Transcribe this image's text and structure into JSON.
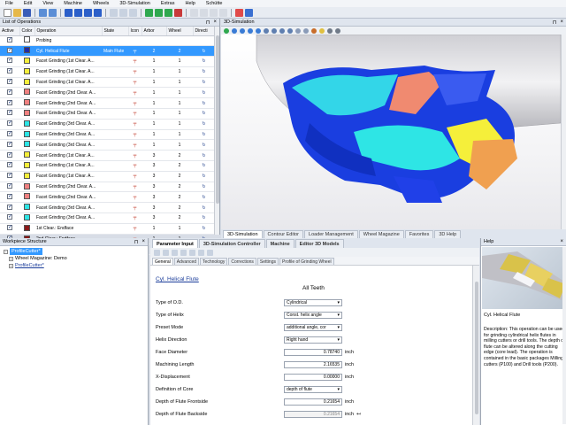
{
  "menu": [
    "File",
    "Edit",
    "View",
    "Machine",
    "Wheels",
    "3D-Simulation",
    "Extras",
    "Help",
    "Schütte"
  ],
  "operations": {
    "title": "List of Operations",
    "columns": [
      "Active",
      "Color",
      "Operation",
      "State",
      "Icon",
      "Arbor",
      "Wheel",
      "Directi"
    ],
    "rows": [
      {
        "color": "#ffffff",
        "name": "Probing",
        "state": "",
        "arbor": "",
        "wheel": "",
        "dir": false
      },
      {
        "color": "#1e2aa8",
        "name": "Cyl. Helical Flute",
        "state": "Main Flute",
        "arbor": "2",
        "wheel": "2",
        "dir": true,
        "selected": true
      },
      {
        "color": "#f5ef3a",
        "name": "Facet Grinding (1st Clear. A...",
        "state": "",
        "arbor": "1",
        "wheel": "1",
        "dir": true
      },
      {
        "color": "#f5ef3a",
        "name": "Facet Grinding (1st Clear. A...",
        "state": "",
        "arbor": "1",
        "wheel": "1",
        "dir": true
      },
      {
        "color": "#f5ef3a",
        "name": "Facet Grinding (1st Clear. A...",
        "state": "",
        "arbor": "1",
        "wheel": "1",
        "dir": true
      },
      {
        "color": "#f08080",
        "name": "Facet Grinding (2nd Clear. A...",
        "state": "",
        "arbor": "1",
        "wheel": "1",
        "dir": true
      },
      {
        "color": "#f08080",
        "name": "Facet Grinding (2nd Clear. A...",
        "state": "",
        "arbor": "1",
        "wheel": "1",
        "dir": true
      },
      {
        "color": "#f08080",
        "name": "Facet Grinding (2nd Clear. A...",
        "state": "",
        "arbor": "1",
        "wheel": "1",
        "dir": true
      },
      {
        "color": "#2ee5e5",
        "name": "Facet Grinding (3rd Clear. A...",
        "state": "",
        "arbor": "1",
        "wheel": "1",
        "dir": true
      },
      {
        "color": "#2ee5e5",
        "name": "Facet Grinding (3rd Clear. A...",
        "state": "",
        "arbor": "1",
        "wheel": "1",
        "dir": true
      },
      {
        "color": "#2ee5e5",
        "name": "Facet Grinding (3rd Clear. A...",
        "state": "",
        "arbor": "1",
        "wheel": "1",
        "dir": true
      },
      {
        "color": "#f5ef3a",
        "name": "Facet Grinding (1st Clear. A...",
        "state": "",
        "arbor": "3",
        "wheel": "2",
        "dir": true
      },
      {
        "color": "#f5ef3a",
        "name": "Facet Grinding (1st Clear. A...",
        "state": "",
        "arbor": "3",
        "wheel": "2",
        "dir": true
      },
      {
        "color": "#f5ef3a",
        "name": "Facet Grinding (1st Clear. A...",
        "state": "",
        "arbor": "3",
        "wheel": "2",
        "dir": true
      },
      {
        "color": "#f08080",
        "name": "Facet Grinding (2nd Clear. A...",
        "state": "",
        "arbor": "3",
        "wheel": "2",
        "dir": true
      },
      {
        "color": "#f08080",
        "name": "Facet Grinding (2nd Clear. A...",
        "state": "",
        "arbor": "3",
        "wheel": "2",
        "dir": true
      },
      {
        "color": "#2ee5e5",
        "name": "Facet Grinding (3rd Clear. A...",
        "state": "",
        "arbor": "3",
        "wheel": "2",
        "dir": true
      },
      {
        "color": "#2ee5e5",
        "name": "Facet Grinding (3rd Clear. A...",
        "state": "",
        "arbor": "3",
        "wheel": "2",
        "dir": true
      },
      {
        "color": "#8b1a1a",
        "name": "1st Clear.: Endface",
        "state": "",
        "arbor": "1",
        "wheel": "1",
        "dir": true
      },
      {
        "color": "#8b1a1a",
        "name": "2nd Clear.: Endface",
        "state": "",
        "arbor": "1",
        "wheel": "1",
        "dir": true
      },
      {
        "color": "#ff8c00",
        "name": "End Gash",
        "state": "",
        "arbor": "3",
        "wheel": "2",
        "dir": true
      }
    ]
  },
  "simulation": {
    "title": "3D-Simulation",
    "tabs": [
      "3D-Simulation",
      "Contour Editor",
      "Loader Management",
      "Wheel Magazine",
      "Favorites",
      "3D Help"
    ],
    "active_tab": 0
  },
  "workpiece": {
    "title": "Workpiece Structure",
    "items": [
      "ProfileCutter*",
      "Wheel Magazine: Demo",
      "ProfileCutter*"
    ]
  },
  "param": {
    "tabs": [
      "Parameter Input",
      "3D-Simulation Controller",
      "Machine",
      "Editor 3D Models"
    ],
    "subtabs": [
      "General",
      "Advanced",
      "Technology",
      "Corrections",
      "Settings",
      "Profile of Grinding Wheel"
    ],
    "operation_link": "Cyl. Helical Flute",
    "heading": "All Teeth",
    "fields": [
      {
        "label": "Type of O.D.",
        "value": "Cylindrical",
        "type": "select",
        "unit": ""
      },
      {
        "label": "Type of Helix",
        "value": "Const. helix angle",
        "type": "select",
        "unit": ""
      },
      {
        "label": "Preset Mode",
        "value": "additional angle, cor",
        "type": "select",
        "unit": ""
      },
      {
        "label": "Helix Direction",
        "value": "Right hand",
        "type": "select",
        "unit": ""
      },
      {
        "label": "Face Diameter",
        "value": "0.78740",
        "type": "input",
        "unit": "inch"
      },
      {
        "label": "Machining Length",
        "value": "2.16535",
        "type": "input",
        "unit": "inch"
      },
      {
        "label": "X-Displacement",
        "value": "0.00000",
        "type": "input",
        "unit": "inch"
      },
      {
        "label": "Definition of Core",
        "value": "depth of flute",
        "type": "select",
        "unit": ""
      },
      {
        "label": "Depth of Flute Frontside",
        "value": "0.21654",
        "type": "input",
        "unit": "inch"
      },
      {
        "label": "Depth of Flute Backside",
        "value": "0.21654",
        "type": "dim",
        "unit": "inch"
      }
    ]
  },
  "help": {
    "title": "Help",
    "heading": "Cyl. Helical Flute",
    "text": "Description: This operation can be used for grinding cylindrical helix flutes in milling cutters or drill tools. The depth of flute can be altered along the cutting edge (core lead). The operation is contained in the basic packages Milling cutters (P100) and Drill tools (P200)."
  }
}
